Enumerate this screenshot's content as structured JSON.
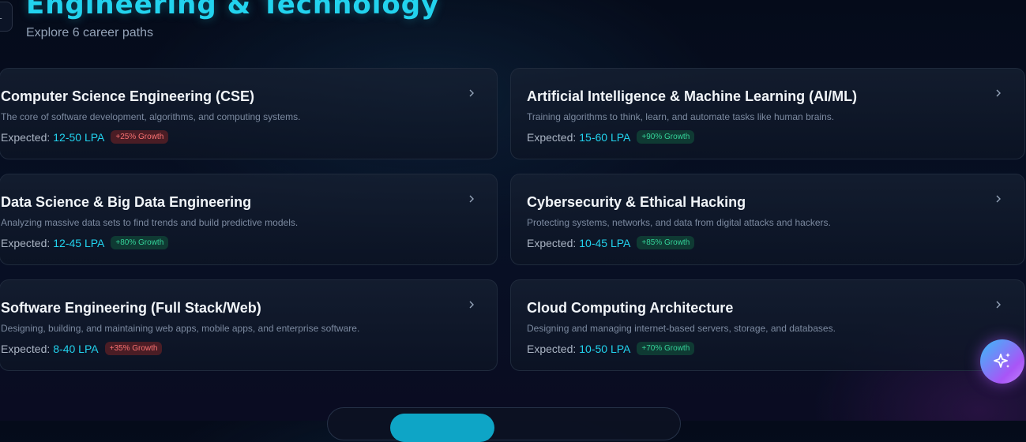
{
  "header": {
    "back_icon": "arrow-left-icon",
    "title": "Engineering & Technology",
    "subtitle": "Explore 6 career paths"
  },
  "expected_label": "Expected:",
  "colors": {
    "accent": "#22d3ee",
    "growth_up": "#34d399",
    "growth_down": "#f87171"
  },
  "careers": [
    {
      "title": "Computer Science Engineering (CSE)",
      "description": "The core of software development, algorithms, and computing systems.",
      "salary": "12-50 LPA",
      "growth": "+25% Growth",
      "growth_tone": "down"
    },
    {
      "title": "Artificial Intelligence & Machine Learning (AI/ML)",
      "description": "Training algorithms to think, learn, and automate tasks like human brains.",
      "salary": "15-60 LPA",
      "growth": "+90% Growth",
      "growth_tone": "up"
    },
    {
      "title": "Data Science & Big Data Engineering",
      "description": "Analyzing massive data sets to find trends and build predictive models.",
      "salary": "12-45 LPA",
      "growth": "+80% Growth",
      "growth_tone": "up"
    },
    {
      "title": "Cybersecurity & Ethical Hacking",
      "description": "Protecting systems, networks, and data from digital attacks and hackers.",
      "salary": "10-45 LPA",
      "growth": "+85% Growth",
      "growth_tone": "up"
    },
    {
      "title": "Software Engineering (Full Stack/Web)",
      "description": "Designing, building, and maintaining web apps, mobile apps, and enterprise software.",
      "salary": "8-40 LPA",
      "growth": "+35% Growth",
      "growth_tone": "down"
    },
    {
      "title": "Cloud Computing Architecture",
      "description": "Designing and managing internet-based servers, storage, and databases.",
      "salary": "10-50 LPA",
      "growth": "+70% Growth",
      "growth_tone": "up"
    }
  ],
  "fab": {
    "icon": "sparkles-icon"
  }
}
